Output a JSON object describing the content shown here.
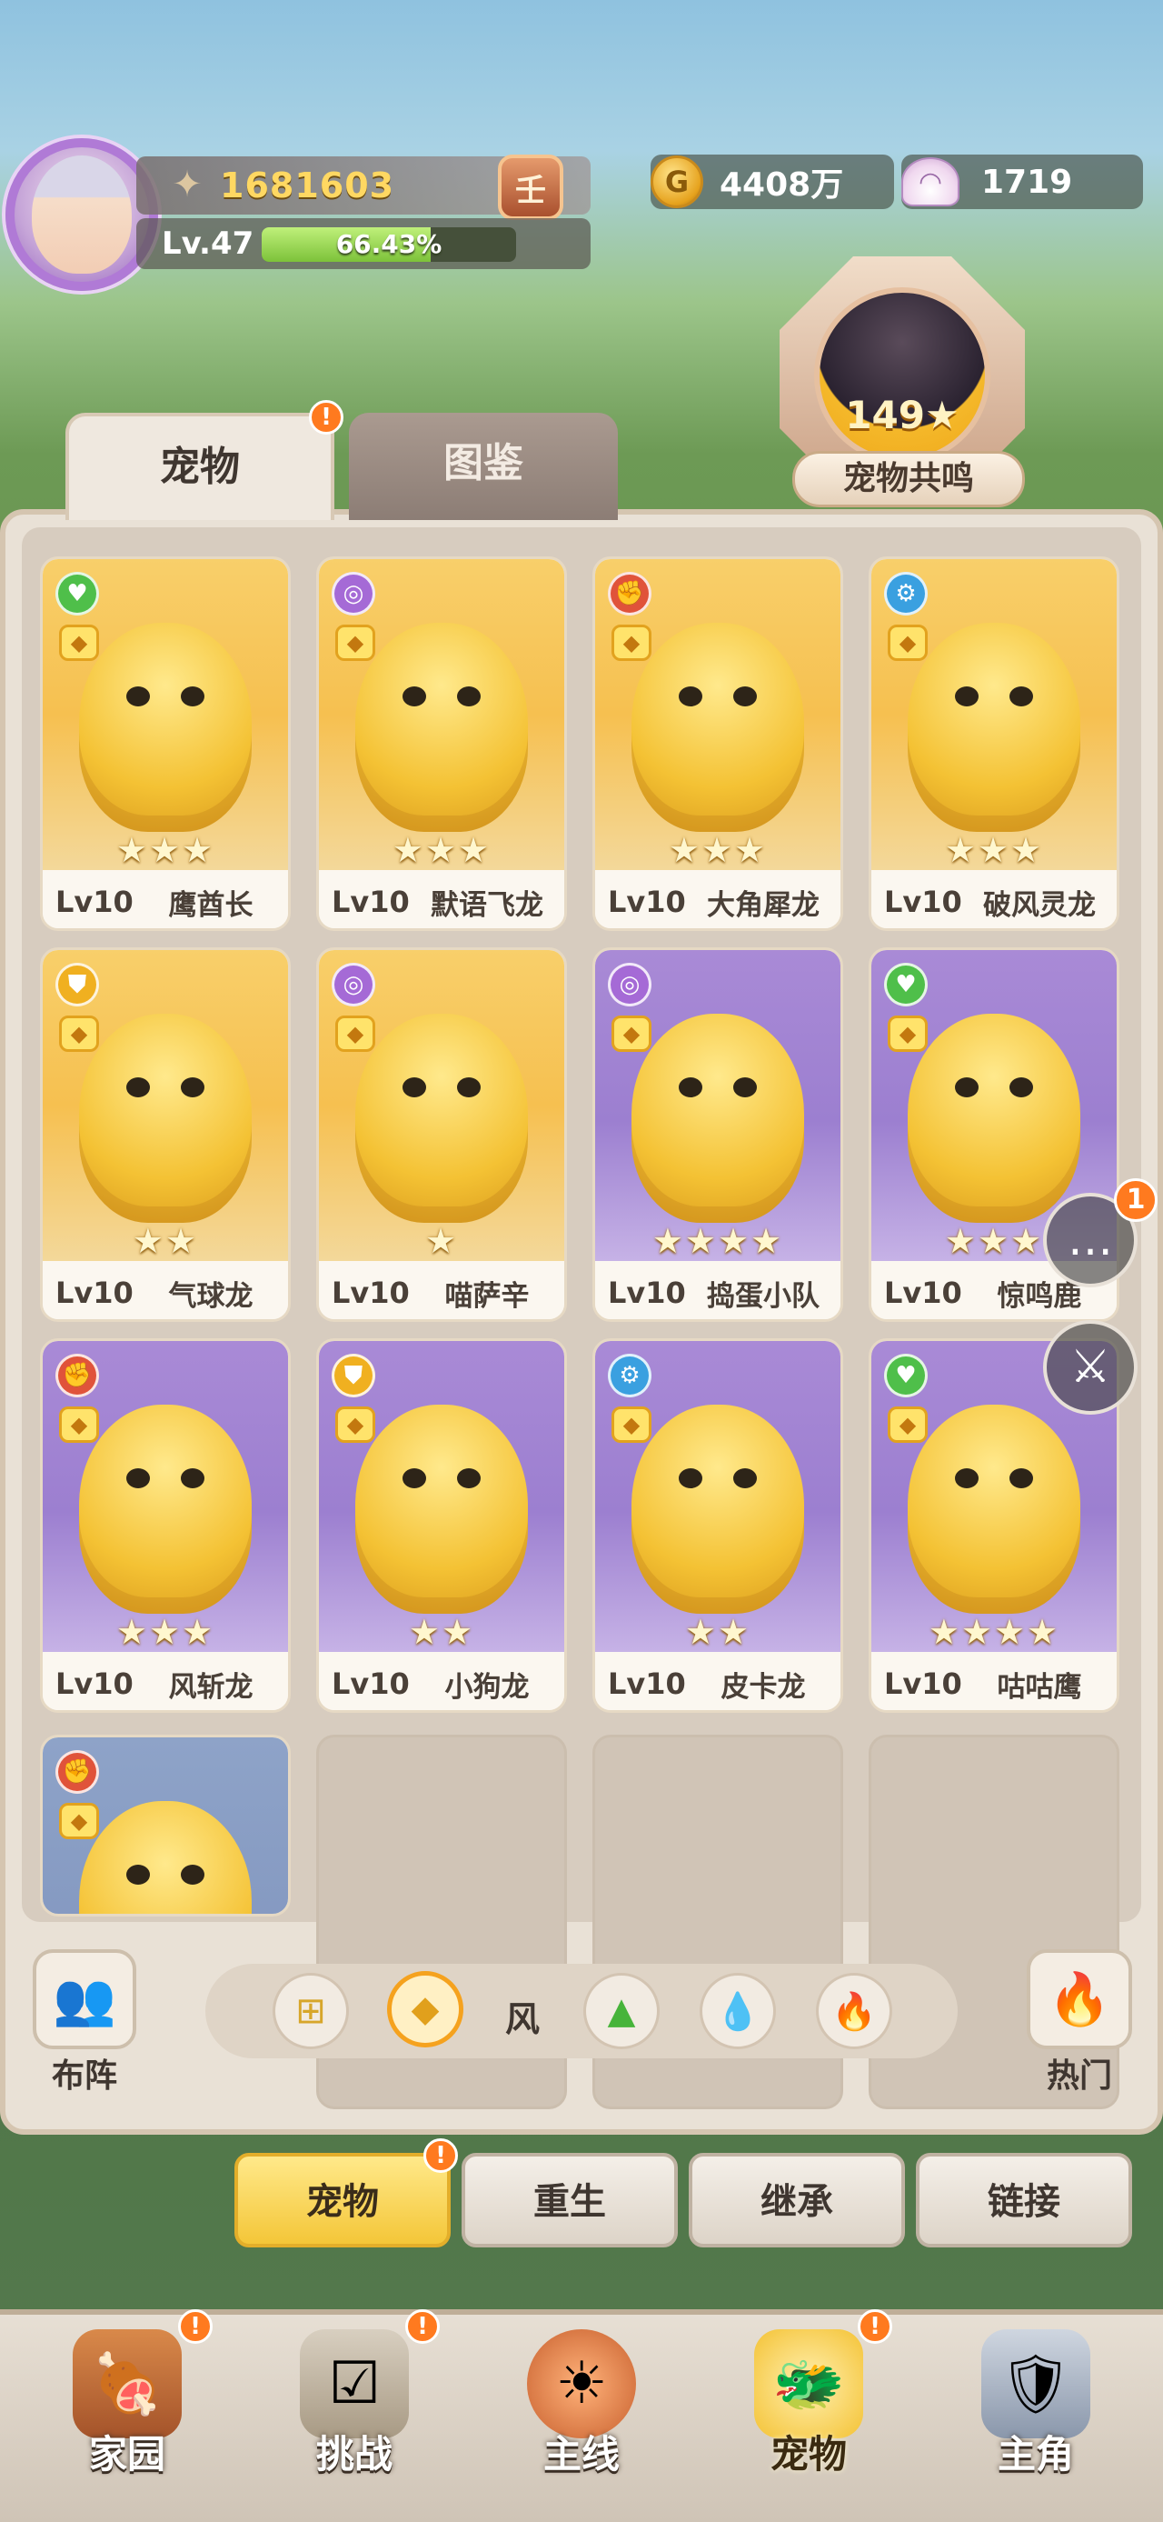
{
  "player": {
    "power": "1681603",
    "level": "Lv.47",
    "exp_percent": "66.43%",
    "exp_fraction": 0.6643,
    "rank_badge": "壬"
  },
  "currency": {
    "gold": "4408万",
    "shells": "1719"
  },
  "resonance": {
    "count": "149★",
    "label": "宠物共鸣"
  },
  "tabs": {
    "pets": "宠物",
    "codex": "图鉴"
  },
  "pets": [
    {
      "level": "Lv10",
      "name": "鹰酋长",
      "stars": "★★★",
      "element": "grass",
      "frame": "gold"
    },
    {
      "level": "Lv10",
      "name": "默语飞龙",
      "stars": "★★★",
      "element": "psychic",
      "frame": "gold"
    },
    {
      "level": "Lv10",
      "name": "大角犀龙",
      "stars": "★★★",
      "element": "fighting",
      "frame": "gold"
    },
    {
      "level": "Lv10",
      "name": "破风灵龙",
      "stars": "★★★",
      "element": "mech",
      "frame": "gold"
    },
    {
      "level": "Lv10",
      "name": "气球龙",
      "stars": "★★",
      "element": "guard",
      "frame": "gold"
    },
    {
      "level": "Lv10",
      "name": "喵萨辛",
      "stars": "★",
      "element": "psychic",
      "frame": "gold"
    },
    {
      "level": "Lv10",
      "name": "捣蛋小队",
      "stars": "★★★★",
      "element": "psychic",
      "frame": "purple"
    },
    {
      "level": "Lv10",
      "name": "惊鸣鹿",
      "stars": "★★★",
      "element": "grass",
      "frame": "purple"
    },
    {
      "level": "Lv10",
      "name": "风斩龙",
      "stars": "★★★",
      "element": "fighting",
      "frame": "purple"
    },
    {
      "level": "Lv10",
      "name": "小狗龙",
      "stars": "★★",
      "element": "guard",
      "frame": "purple"
    },
    {
      "level": "Lv10",
      "name": "皮卡龙",
      "stars": "★★",
      "element": "mech",
      "frame": "purple"
    },
    {
      "level": "Lv10",
      "name": "咕咕鹰",
      "stars": "★★★★",
      "element": "grass",
      "frame": "purple"
    },
    {
      "level": "",
      "name": "",
      "stars": "",
      "element": "fighting",
      "frame": "blue"
    }
  ],
  "side_buttons": {
    "chat_badge": "1"
  },
  "badges": {
    "alert": "!"
  },
  "filter": {
    "formation_label": "布阵",
    "selected_element_label": "风",
    "hot_label": "热门"
  },
  "subtabs": {
    "pets": "宠物",
    "rebirth": "重生",
    "inherit": "继承",
    "link": "链接"
  },
  "nav": {
    "home": "家园",
    "challenge": "挑战",
    "main": "主线",
    "pets": "宠物",
    "hero": "主角"
  },
  "colors": {
    "accent_gold": "#f4c234",
    "badge_orange": "#ff7a1f",
    "grass": "#4fbf4a",
    "psychic": "#a56ad6",
    "fighting": "#e0533a",
    "mech": "#3aa0e0",
    "guard": "#f0b020"
  }
}
